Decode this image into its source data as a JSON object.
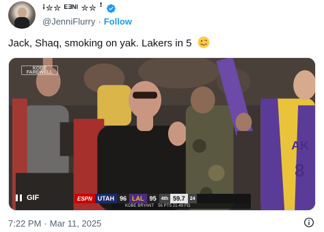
{
  "author": {
    "display_name": "ꜟ✮✮ ᴱᴲᴺᴵ ✮✮ ꜝ",
    "handle": "@JenniFlurry",
    "separator": "·",
    "follow_label": "Follow",
    "verified_color": "#1d9bf0"
  },
  "tweet": {
    "text": "Jack, Shaq, smoking on yak. Lakers in 5",
    "emoji": "woozy-face-emoji"
  },
  "media": {
    "type": "GIF",
    "gif_label": "GIF",
    "logo_text": "KOBE FAREWELL",
    "scorebug": {
      "network": "ESPN",
      "away_team": "UTAH",
      "away_score": "96",
      "home_team": "LAL",
      "home_score": "95",
      "quarter": "4th",
      "clock": "59.7",
      "shot_clock": "24",
      "player_line": "KOBE BRYANT",
      "player_stats": "56 PTS 21-49 FG"
    },
    "colors": {
      "lakers_purple": "#4b2e83",
      "lakers_gold": "#fdb927",
      "espn_red": "#cc0000"
    }
  },
  "footer": {
    "time": "7:22 PM",
    "separator": "·",
    "date": "Mar 11, 2025",
    "info_icon": "info-icon"
  }
}
